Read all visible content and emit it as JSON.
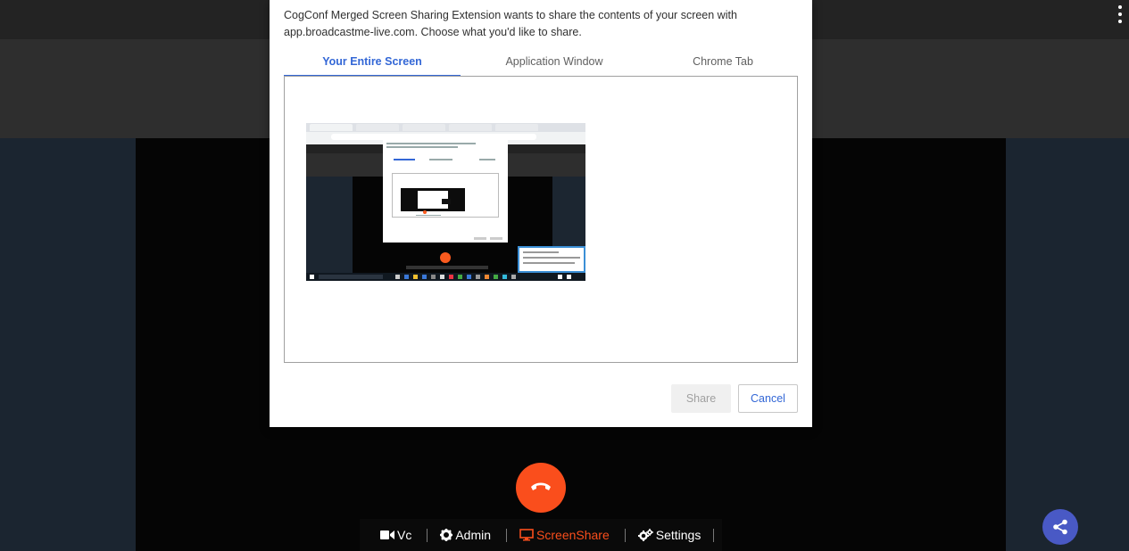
{
  "dialog": {
    "message": "CogConf Merged Screen Sharing Extension wants to share the contents of your screen with app.broadcastme-live.com. Choose what you'd like to share.",
    "tabs": [
      {
        "label": "Your Entire Screen",
        "active": true
      },
      {
        "label": "Application Window",
        "active": false
      },
      {
        "label": "Chrome Tab",
        "active": false
      }
    ],
    "share_label": "Share",
    "cancel_label": "Cancel"
  },
  "toolbar": {
    "items": [
      {
        "label": "Vc",
        "icon": "video-camera-icon"
      },
      {
        "label": "Admin",
        "icon": "gear-icon"
      },
      {
        "label": "ScreenShare",
        "icon": "monitor-icon",
        "active": true
      },
      {
        "label": "Settings",
        "icon": "gears-icon"
      }
    ]
  },
  "colors": {
    "accent": "#3367d6",
    "hangup": "#fa4e1c",
    "share_fab": "#4959c5",
    "active_tool": "#fa4e1c"
  }
}
